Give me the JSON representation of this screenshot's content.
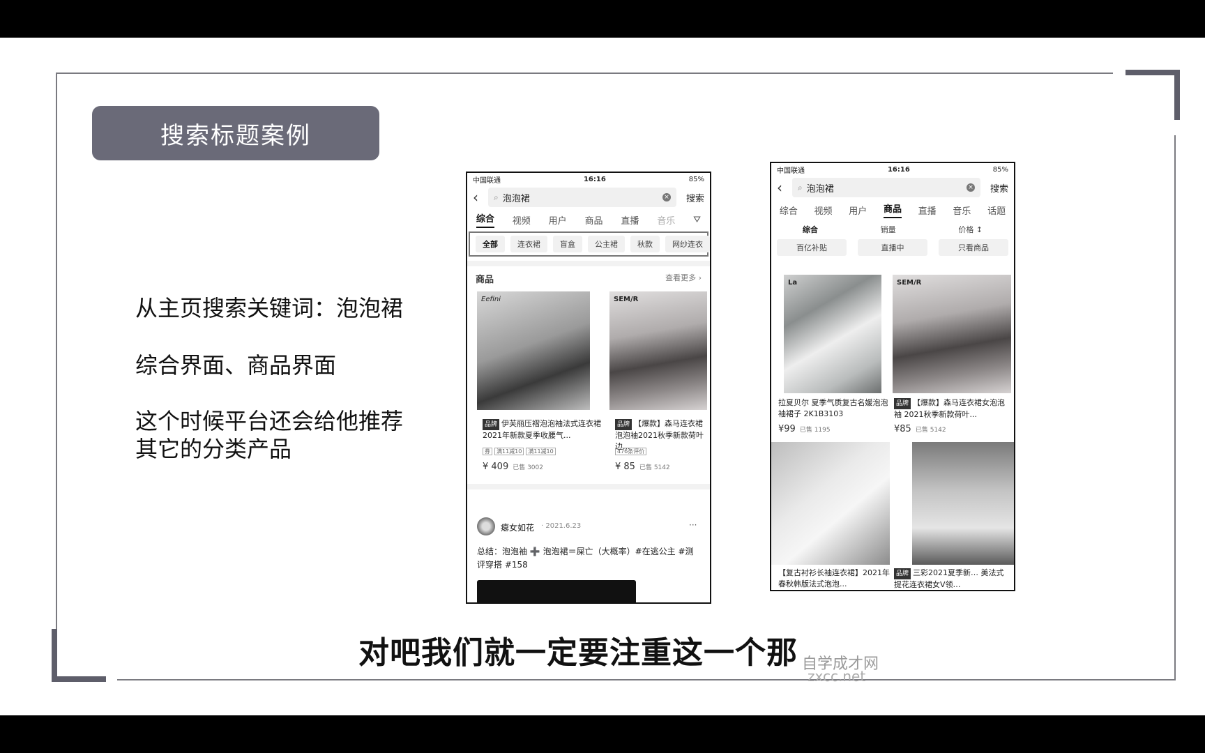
{
  "slide": {
    "title": "搜索标题案例",
    "bullets": [
      "从主页搜索关键词：泡泡裙",
      "综合界面、商品界面",
      "这个时候平台还会给他推荐",
      "其它的分类产品"
    ],
    "subtitle": "对吧我们就一定要注重这一个那",
    "watermark_cn": "自学成才网",
    "watermark_en": "zxcc.net"
  },
  "phone1": {
    "status": {
      "carrier": "中国联通",
      "time": "16:16",
      "battery": "85%"
    },
    "search_value": "泡泡裙",
    "search_button": "搜索",
    "tabs": [
      "综合",
      "视频",
      "用户",
      "商品",
      "直播",
      "音乐"
    ],
    "chips": [
      "全部",
      "连衣裙",
      "盲盒",
      "公主裙",
      "秋款",
      "网纱连衣"
    ],
    "section_title": "商品",
    "section_more": "查看更多 ›",
    "products": [
      {
        "brand_mark": "Eefini",
        "tag": "品牌",
        "title": "伊芙丽压褶泡泡袖法式连衣裙2021年新款夏季收腰气...",
        "coupons": [
          "券",
          "满11减10",
          "满11减10"
        ],
        "price": "¥ 409",
        "sold": "已售 3002"
      },
      {
        "brand_mark": "SEM/R",
        "tag": "品牌",
        "title": "【爆款】森马连衣裙泡泡袖2021秋季新款荷叶边...",
        "coupons": [
          "476条评价"
        ],
        "price": "¥ 85",
        "sold": "已售 5142"
      }
    ],
    "post": {
      "author": "瘪女如花",
      "date": "· 2021.6.23",
      "text": "总结：泡泡袖 ➕ 泡泡裙＝屎亡（大概率）#在逃公主 #测评穿搭 #158",
      "more": "···"
    }
  },
  "phone2": {
    "status": {
      "carrier": "中国联通",
      "time": "16:16",
      "battery": "85%"
    },
    "search_value": "泡泡裙",
    "search_button": "搜索",
    "tabs": [
      "综合",
      "视频",
      "用户",
      "商品",
      "直播",
      "音乐",
      "话题"
    ],
    "active_tab": "商品",
    "sorts": [
      "综合",
      "销量",
      "价格 ↕"
    ],
    "filters": [
      "百亿补贴",
      "直播中",
      "只看商品"
    ],
    "products": [
      {
        "brand_mark": "La",
        "title": "拉夏贝尔 夏季气质复古名媛泡泡袖裙子 2K1B3103",
        "price": "¥99",
        "sold": "已售 1195"
      },
      {
        "brand_mark": "SEM/R",
        "tag": "品牌",
        "title": "【爆款】森马连衣裙女泡泡袖 2021秋季新款荷叶...",
        "price": "¥85",
        "sold": "已售 5142"
      },
      {
        "brand_mark": "",
        "title": "【复古衬衫长袖连衣裙】2021年春秋韩版法式泡泡...",
        "price": "",
        "sold": ""
      },
      {
        "brand_mark": "",
        "tag": "品牌",
        "title": "三彩2021夏季新… 美法式提花连衣裙女V领…",
        "price": "",
        "sold": ""
      }
    ]
  }
}
